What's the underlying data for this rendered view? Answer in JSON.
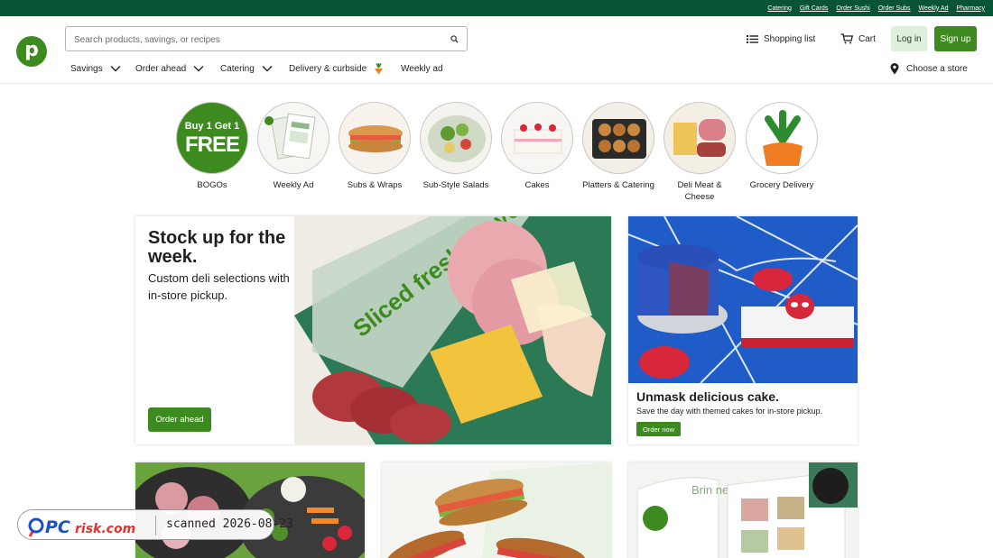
{
  "utility_links": [
    "Catering",
    "Gift Cards",
    "Order Sushi",
    "Order Subs",
    "Weekly Ad",
    "Pharmacy"
  ],
  "brand": {
    "logo_letter": "p",
    "primary_color": "#3d8a1f",
    "dark_green": "#0a5436"
  },
  "search": {
    "placeholder": "Search products, savings, or recipes",
    "icon": "search-icon"
  },
  "header": {
    "shopping_list": "Shopping list",
    "cart": "Cart",
    "login": "Log in",
    "signup": "Sign up"
  },
  "nav": {
    "savings": "Savings",
    "order_ahead": "Order ahead",
    "catering": "Catering",
    "delivery": "Delivery & curbside",
    "weekly_ad": "Weekly ad",
    "choose_store": "Choose a store"
  },
  "categories": [
    {
      "label": "BOGOs",
      "badge_line1": "Buy 1 Get 1",
      "badge_line2": "FREE"
    },
    {
      "label": "Weekly Ad"
    },
    {
      "label": "Subs & Wraps"
    },
    {
      "label": "Sub-Style Salads"
    },
    {
      "label": "Cakes"
    },
    {
      "label": "Platters & Catering"
    },
    {
      "label": "Deli Meat & Cheese"
    },
    {
      "label": "Grocery Delivery"
    }
  ],
  "hero": {
    "title": "Stock up for the week.",
    "subtitle": "Custom deli selections with in-store pickup.",
    "button": "Order ahead",
    "image_text": "Sliced fresh for you."
  },
  "cake_promo": {
    "title": "Unmask delicious cake.",
    "subtitle": "Save the day with themed cakes for in-store pickup.",
    "button": "Order now"
  },
  "bottom_cards": [
    {
      "name": "party-platter"
    },
    {
      "name": "subs"
    },
    {
      "name": "weekly-ad-magazine",
      "image_text": "Brin ne"
    }
  ],
  "watermark": {
    "brand": "PCrisk.com",
    "stamp": "scanned 2026-08-23"
  }
}
